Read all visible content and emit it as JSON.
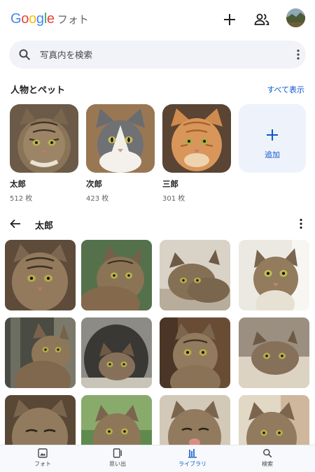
{
  "header": {
    "logo_text": "Google",
    "app_name": "フォト"
  },
  "search": {
    "placeholder": "写真内を検索"
  },
  "people_section": {
    "title": "人物とペット",
    "see_all": "すべて表示",
    "people": [
      {
        "name": "太郎",
        "count": "512 枚"
      },
      {
        "name": "次郎",
        "count": "423 枚"
      },
      {
        "name": "三郎",
        "count": "301 枚"
      }
    ],
    "add_label": "追加"
  },
  "album": {
    "title": "太郎",
    "photo_count_visible": 12
  },
  "bottom_nav": {
    "items": [
      {
        "label": "フォト",
        "icon": "photo-icon"
      },
      {
        "label": "思い出",
        "icon": "memories-icon"
      },
      {
        "label": "ライブラリ",
        "icon": "library-icon"
      },
      {
        "label": "検索",
        "icon": "search-icon"
      }
    ],
    "active": "ライブラリ"
  },
  "colors": {
    "accent": "#0b57d0",
    "search_bg": "#f1f3f8",
    "google_blue": "#4285f4",
    "google_red": "#ea4335",
    "google_yellow": "#fbbc05",
    "google_green": "#34a853"
  }
}
